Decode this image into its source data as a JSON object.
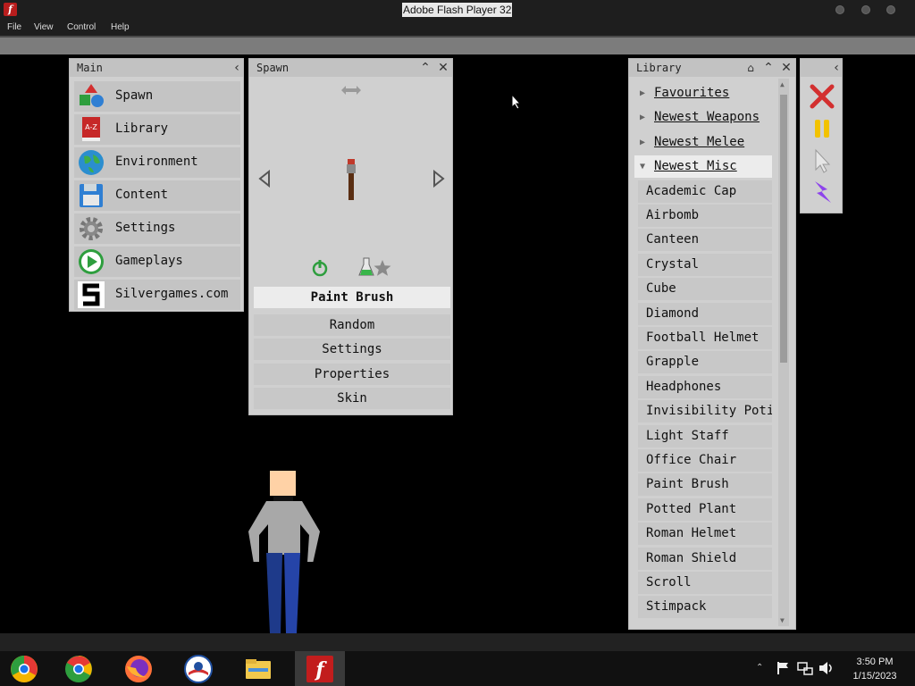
{
  "window": {
    "title": "Adobe Flash Player 32"
  },
  "menubar": {
    "items": [
      "File",
      "View",
      "Control",
      "Help"
    ]
  },
  "main_panel": {
    "title": "Main",
    "items": [
      {
        "label": "Spawn",
        "icon": "spawn-shapes-icon"
      },
      {
        "label": "Library",
        "icon": "library-book-icon"
      },
      {
        "label": "Environment",
        "icon": "globe-icon"
      },
      {
        "label": "Content",
        "icon": "floppy-disk-icon"
      },
      {
        "label": "Settings",
        "icon": "gear-icon"
      },
      {
        "label": "Gameplays",
        "icon": "play-icon"
      },
      {
        "label": "Silvergames.com",
        "icon": "silvergames-logo-icon"
      }
    ]
  },
  "spawn_panel": {
    "title": "Spawn",
    "selected_item": "Paint Brush",
    "buttons": [
      "Random",
      "Settings",
      "Properties",
      "Skin"
    ]
  },
  "library_panel": {
    "title": "Library",
    "categories": [
      {
        "label": "Favourites",
        "expanded": false
      },
      {
        "label": "Newest Weapons",
        "expanded": false
      },
      {
        "label": "Newest Melee",
        "expanded": false
      },
      {
        "label": "Newest Misc",
        "expanded": true
      }
    ],
    "items": [
      "Academic Cap",
      "Airbomb",
      "Canteen",
      "Crystal",
      "Cube",
      "Diamond",
      "Football Helmet",
      "Grapple",
      "Headphones",
      "Invisibility Potion",
      "Light Staff",
      "Office Chair",
      "Paint Brush",
      "Potted Plant",
      "Roman Helmet",
      "Roman Shield",
      "Scroll",
      "Stimpack"
    ]
  },
  "tools_panel": {
    "tools": [
      "delete-tool-icon",
      "pause-icon",
      "cursor-tool-icon",
      "lightning-tool-icon"
    ]
  },
  "taskbar": {
    "apps": [
      "chrome-canary-icon",
      "chrome-icon",
      "firefox-icon",
      "obama-logo-icon",
      "file-explorer-icon",
      "flash-player-icon"
    ],
    "time": "3:50 PM",
    "date": "1/15/2023"
  },
  "colors": {
    "panel_bg": "#d0d0d0",
    "selected_row": "#ececec",
    "stage_bg": "#000000"
  }
}
